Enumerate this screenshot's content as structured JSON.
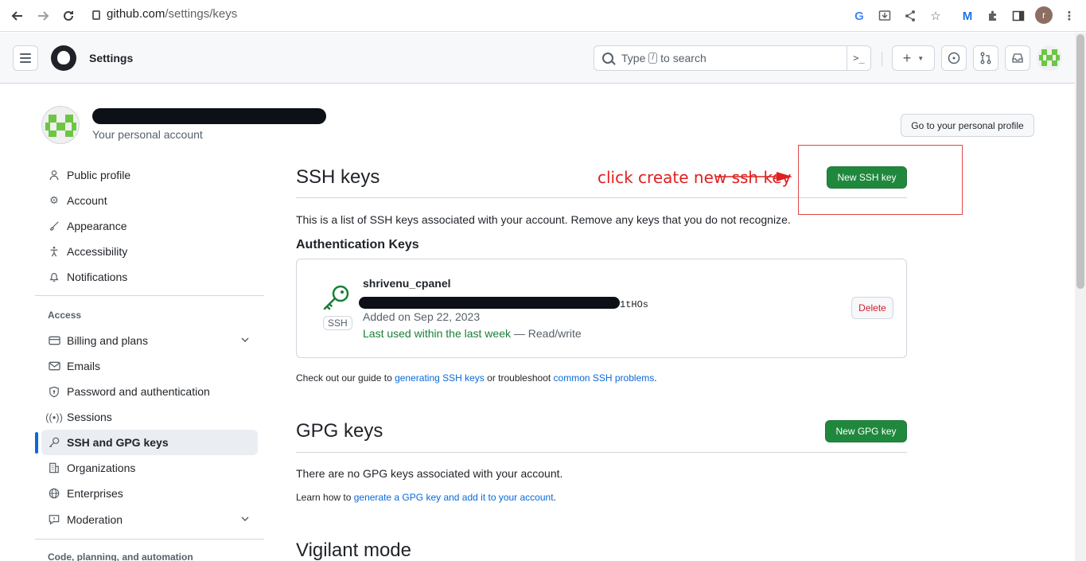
{
  "browser": {
    "url_host": "github.com",
    "url_path": "/settings/keys",
    "profile_initial": "r"
  },
  "header": {
    "title": "Settings",
    "search_before": "Type",
    "search_key": "/",
    "search_after": "to search",
    "command_glyph": ">_",
    "new_glyph": "+"
  },
  "profile": {
    "subtitle": "Your personal account",
    "go_profile_label": "Go to your personal profile"
  },
  "sidebar": {
    "items_top": [
      {
        "label": "Public profile",
        "icon": "person-icon"
      },
      {
        "label": "Account",
        "icon": "gear-icon"
      },
      {
        "label": "Appearance",
        "icon": "paintbrush-icon"
      },
      {
        "label": "Accessibility",
        "icon": "accessibility-icon"
      },
      {
        "label": "Notifications",
        "icon": "bell-icon"
      }
    ],
    "access_heading": "Access",
    "items_access": [
      {
        "label": "Billing and plans",
        "icon": "credit-card-icon"
      },
      {
        "label": "Emails",
        "icon": "mail-icon"
      },
      {
        "label": "Password and authentication",
        "icon": "shield-lock-icon"
      },
      {
        "label": "Sessions",
        "icon": "broadcast-icon"
      },
      {
        "label": "SSH and GPG keys",
        "icon": "key-icon"
      },
      {
        "label": "Organizations",
        "icon": "organization-icon"
      },
      {
        "label": "Enterprises",
        "icon": "globe-icon"
      },
      {
        "label": "Moderation",
        "icon": "report-icon"
      }
    ],
    "code_heading": "Code, planning, and automation"
  },
  "ssh": {
    "title": "SSH keys",
    "new_button": "New SSH key",
    "description": "This is a list of SSH keys associated with your account. Remove any keys that you do not recognize.",
    "auth_title": "Authentication Keys",
    "key": {
      "name": "shrivenu_cpanel",
      "fingerprint_tail": "1tHOs",
      "type_label": "SSH",
      "added": "Added on Sep 22, 2023",
      "last_used": "Last used within the last week",
      "access": "— Read/write",
      "delete_label": "Delete"
    },
    "guide_prefix": "Check out our guide to ",
    "guide_link1": "generating SSH keys",
    "guide_mid": " or troubleshoot ",
    "guide_link2": "common SSH problems",
    "guide_suffix": "."
  },
  "gpg": {
    "title": "GPG keys",
    "new_button": "New GPG key",
    "empty": "There are no GPG keys associated with your account.",
    "learn_prefix": "Learn how to ",
    "learn_link": "generate a GPG key and add it to your account",
    "learn_suffix": "."
  },
  "vigilant": {
    "title": "Vigilant mode"
  },
  "annotation": {
    "text": "click create new ssh key",
    "color": "#e02020"
  },
  "colors": {
    "primary_green": "#1f883d",
    "link_blue": "#0969da",
    "active_indicator": "#0969da",
    "danger": "#cf222e"
  }
}
